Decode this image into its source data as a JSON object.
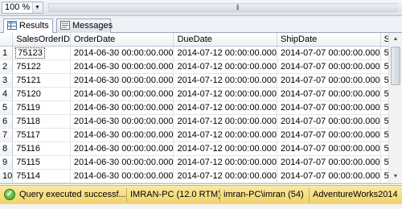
{
  "toolbar": {
    "zoom_value": "100 %"
  },
  "tabs": [
    {
      "label": "Results",
      "active": true,
      "icon": "grid-icon"
    },
    {
      "label": "Messages",
      "active": false,
      "icon": "messages-icon"
    }
  ],
  "grid": {
    "columns": [
      "SalesOrderID",
      "OrderDate",
      "DueDate",
      "ShipDate",
      "Status"
    ],
    "rows": [
      [
        "1",
        "75123",
        "2014-06-30 00:00:00.000",
        "2014-07-12 00:00:00.000",
        "2014-07-07 00:00:00.000",
        "5"
      ],
      [
        "2",
        "75122",
        "2014-06-30 00:00:00.000",
        "2014-07-12 00:00:00.000",
        "2014-07-07 00:00:00.000",
        "5"
      ],
      [
        "3",
        "75121",
        "2014-06-30 00:00:00.000",
        "2014-07-12 00:00:00.000",
        "2014-07-07 00:00:00.000",
        "5"
      ],
      [
        "4",
        "75120",
        "2014-06-30 00:00:00.000",
        "2014-07-12 00:00:00.000",
        "2014-07-07 00:00:00.000",
        "5"
      ],
      [
        "5",
        "75119",
        "2014-06-30 00:00:00.000",
        "2014-07-12 00:00:00.000",
        "2014-07-07 00:00:00.000",
        "5"
      ],
      [
        "6",
        "75118",
        "2014-06-30 00:00:00.000",
        "2014-07-12 00:00:00.000",
        "2014-07-07 00:00:00.000",
        "5"
      ],
      [
        "7",
        "75117",
        "2014-06-30 00:00:00.000",
        "2014-07-12 00:00:00.000",
        "2014-07-07 00:00:00.000",
        "5"
      ],
      [
        "8",
        "75116",
        "2014-06-30 00:00:00.000",
        "2014-07-12 00:00:00.000",
        "2014-07-07 00:00:00.000",
        "5"
      ],
      [
        "9",
        "75115",
        "2014-06-30 00:00:00.000",
        "2014-07-12 00:00:00.000",
        "2014-07-07 00:00:00.000",
        "5"
      ],
      [
        "10",
        "75114",
        "2014-06-30 00:00:00.000",
        "2014-07-12 00:00:00.000",
        "2014-07-07 00:00:00.000",
        "5"
      ]
    ]
  },
  "status": {
    "message": "Query executed successf...",
    "server": "IMRAN-PC (12.0 RTM)",
    "user": "imran-PC\\imran (54)",
    "database": "AdventureWorks2014",
    "bar_color": "#f1d36c"
  }
}
